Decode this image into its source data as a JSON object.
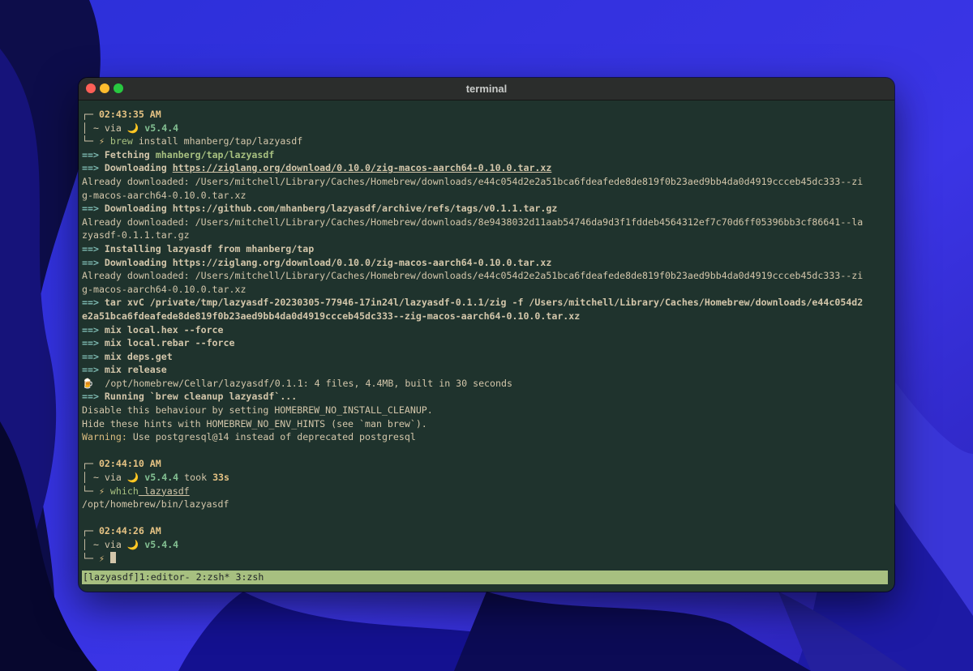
{
  "window": {
    "title": "terminal"
  },
  "prompts": [
    {
      "time": "02:43:35 AM",
      "via": "~ via",
      "moon": "🌙",
      "version": "v5.4.4",
      "took": "",
      "took_value": "",
      "bolt": "⚡",
      "cmd_name": "brew",
      "cmd_args": " install mhanberg/tap/lazyasdf"
    },
    {
      "time": "02:44:10 AM",
      "via": "~ via",
      "moon": "🌙",
      "version": "v5.4.4",
      "took": " took ",
      "took_value": "33s",
      "bolt": "⚡",
      "cmd_name": "which",
      "cmd_args": " lazyasdf"
    },
    {
      "time": "02:44:26 AM",
      "via": "~ via",
      "moon": "🌙",
      "version": "v5.4.4",
      "took": "",
      "took_value": "",
      "bolt": "⚡",
      "cmd_name": "",
      "cmd_args": ""
    }
  ],
  "prompt_decor": {
    "top": "┌─ ",
    "mid": "│ ",
    "bottom": "└─ "
  },
  "output": {
    "arrow": "==>",
    "fetch_label": " Fetching ",
    "fetch_target": "mhanberg/tap/lazyasdf",
    "dl1_label": " Downloading ",
    "dl1_url": "https://ziglang.org/download/0.10.0/zig-macos-aarch64-0.10.0.tar.xz",
    "already1a": "Already downloaded: /Users/mitchell/Library/Caches/Homebrew/downloads/e44c054d2e2a51bca6fdeafede8de819f0b23aed9bb4da0d4919ccceb45dc333--zi",
    "already1b": "g-macos-aarch64-0.10.0.tar.xz",
    "dl2": " Downloading https://github.com/mhanberg/lazyasdf/archive/refs/tags/v0.1.1.tar.gz",
    "already2a": "Already downloaded: /Users/mitchell/Library/Caches/Homebrew/downloads/8e9438032d11aab54746da9d3f1fddeb4564312ef7c70d6ff05396bb3cf86641--la",
    "already2b": "zyasdf-0.1.1.tar.gz",
    "installing": " Installing lazyasdf from mhanberg/tap",
    "dl3": " Downloading https://ziglang.org/download/0.10.0/zig-macos-aarch64-0.10.0.tar.xz",
    "already3a": "Already downloaded: /Users/mitchell/Library/Caches/Homebrew/downloads/e44c054d2e2a51bca6fdeafede8de819f0b23aed9bb4da0d4919ccceb45dc333--zi",
    "already3b": "g-macos-aarch64-0.10.0.tar.xz",
    "tar_a": " tar xvC /private/tmp/lazyasdf-20230305-77946-17in24l/lazyasdf-0.1.1/zig -f /Users/mitchell/Library/Caches/Homebrew/downloads/e44c054d2",
    "tar_b": "e2a51bca6fdeafede8de819f0b23aed9bb4da0d4919ccceb45dc333--zig-macos-aarch64-0.10.0.tar.xz",
    "mix1": " mix local.hex --force",
    "mix2": " mix local.rebar --force",
    "mix3": " mix deps.get",
    "mix4": " mix release",
    "beer": "🍺",
    "cellar": "  /opt/homebrew/Cellar/lazyasdf/0.1.1: 4 files, 4.4MB, built in 30 seconds",
    "cleanup": " Running `brew cleanup lazyasdf`...",
    "hint1": "Disable this behaviour by setting HOMEBREW_NO_INSTALL_CLEANUP.",
    "hint2": "Hide these hints with HOMEBREW_NO_ENV_HINTS (see `man brew`).",
    "warning_label": "Warning:",
    "warning_text": " Use postgresql@14 instead of deprecated postgresql",
    "which_result": "/opt/homebrew/bin/lazyasdf"
  },
  "statusbar": {
    "text": "[lazyasdf]1:editor- 2:zsh* 3:zsh"
  }
}
